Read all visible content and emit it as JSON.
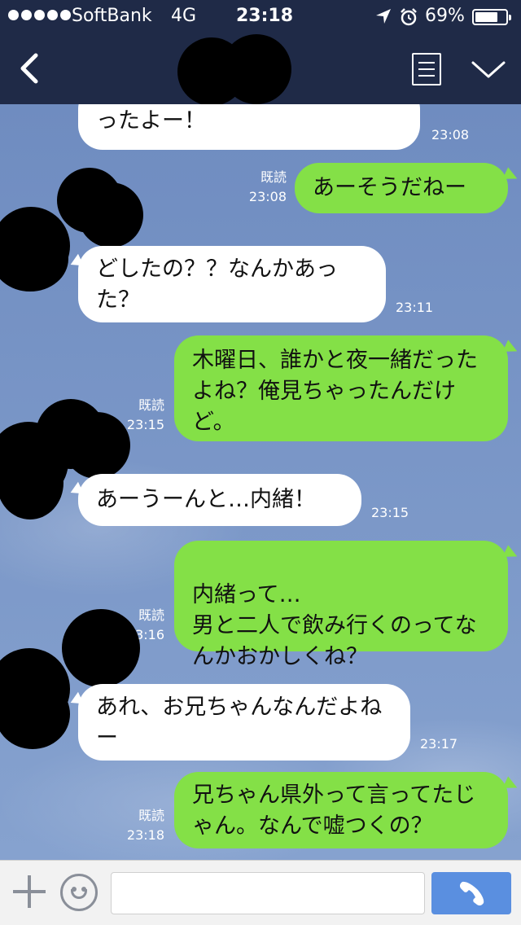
{
  "status_bar": {
    "carrier": "SoftBank",
    "network": "4G",
    "time": "23:18",
    "battery": "69%",
    "icons": [
      "signal-dots",
      "location-arrow-icon",
      "alarm-icon",
      "battery-icon"
    ]
  },
  "header": {
    "title": "",
    "icons": [
      "back-chevron-icon",
      "menu-list-icon",
      "chevron-down-icon"
    ]
  },
  "messages": [
    {
      "side": "recv",
      "text": "ったよー！",
      "time": "23:08",
      "read": ""
    },
    {
      "side": "sent",
      "text": "あーそうだねー",
      "time": "23:08",
      "read": "既読"
    },
    {
      "side": "recv",
      "text": "どしたの？？なんかあった？",
      "time": "23:11",
      "read": ""
    },
    {
      "side": "sent",
      "text": "木曜日、誰かと夜一緒だったよね？俺見ちゃったんだけど。",
      "time": "23:15",
      "read": "既読"
    },
    {
      "side": "recv",
      "text": "あーうーんと…内緒！",
      "time": "23:15",
      "read": ""
    },
    {
      "side": "sent",
      "text": "内緒って…\n男と二人で飲み行くのってなんかおかしくね？",
      "time": "23:16",
      "read": "既読"
    },
    {
      "side": "recv",
      "text": "あれ、お兄ちゃんなんだよねー",
      "time": "23:17",
      "read": ""
    },
    {
      "side": "sent",
      "text": "兄ちゃん県外って言ってたじゃん。なんで嘘つくの？",
      "time": "23:18",
      "read": "既読"
    }
  ],
  "input": {
    "placeholder": "",
    "value": ""
  },
  "colors": {
    "header_bg": "#1f2a47",
    "sent_bubble": "#84e047",
    "recv_bubble": "#ffffff",
    "call_button": "#5a8fe0"
  }
}
